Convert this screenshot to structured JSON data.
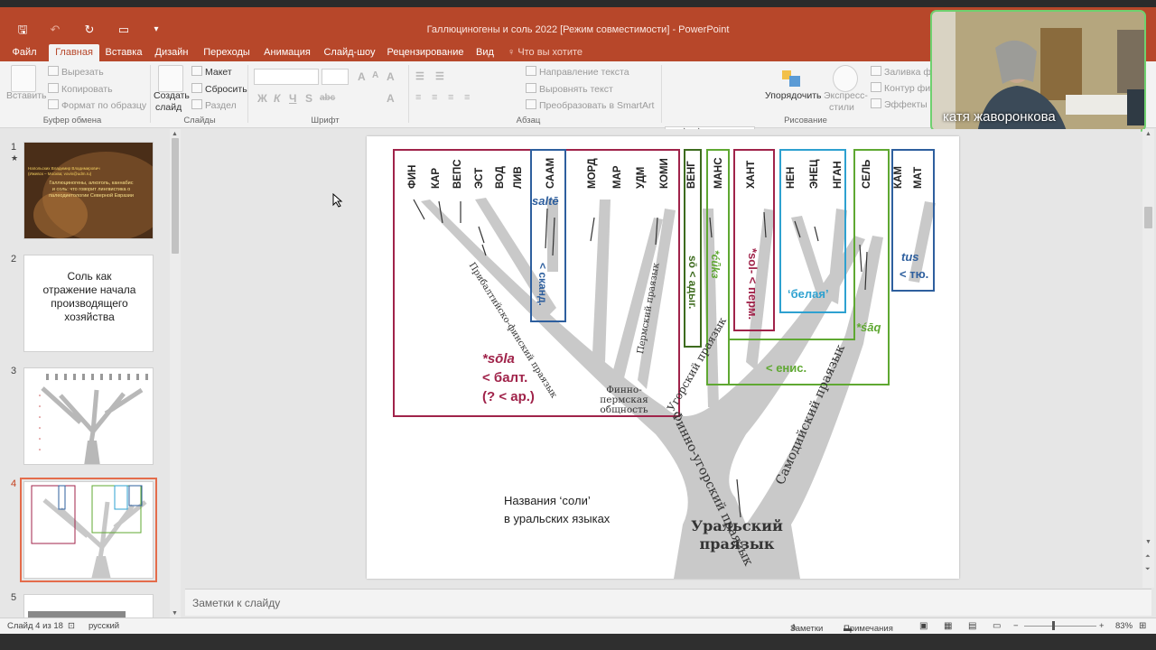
{
  "window": {
    "title": "Галлюциногены и соль 2022 [Режим совместимости] - PowerPoint"
  },
  "quick_access": {
    "icons": [
      "save-icon",
      "undo-icon",
      "redo-icon",
      "present-icon",
      "customize-icon"
    ]
  },
  "tabs": [
    {
      "label": "Файл"
    },
    {
      "label": "Главная"
    },
    {
      "label": "Вставка"
    },
    {
      "label": "Дизайн"
    },
    {
      "label": "Переходы"
    },
    {
      "label": "Анимация"
    },
    {
      "label": "Слайд-шоу"
    },
    {
      "label": "Рецензирование"
    },
    {
      "label": "Вид"
    }
  ],
  "search_tab": "Что вы хотите сделать?",
  "ribbon": {
    "clipboard": {
      "paste": "Вставить",
      "cut": "Вырезать",
      "copy": "Копировать",
      "format_painter": "Формат по образцу",
      "group": "Буфер обмена"
    },
    "slides": {
      "new_slide_line1": "Создать",
      "new_slide_line2": "слайд",
      "layout": "Макет",
      "reset": "Сбросить",
      "section": "Раздел",
      "group": "Слайды"
    },
    "font": {
      "bold": "Ж",
      "italic": "К",
      "underline": "Ч",
      "shadow": "S",
      "strike": "abc",
      "group": "Шрифт"
    },
    "paragraph": {
      "text_direction": "Направление текста",
      "align_text": "Выровнять текст",
      "smartart": "Преобразовать в SmartArt",
      "group": "Абзац"
    },
    "drawing": {
      "arrange": "Упорядочить",
      "quick_styles_line1": "Экспресс-",
      "quick_styles_line2": "стили",
      "shape_fill": "Заливка фи",
      "shape_outline": "Контур фи",
      "shape_effects": "Эффекты ф",
      "group": "Рисование"
    }
  },
  "thumbnails": {
    "slide1": {
      "num": "1",
      "author": "Напольских Владимир Владимирович",
      "affil": "(Ижевск – Москва; vovin@udm.ru)",
      "title": "Галлюциногены, алкоголь, каннабис и соль: что говорит лингвистика о палеодиетологии Северной Евразии"
    },
    "slide2": {
      "num": "2",
      "text": "Соль как отражение начала производящего хозяйства"
    },
    "slide3": {
      "num": "3"
    },
    "slide4": {
      "num": "4"
    },
    "slide5": {
      "num": "5"
    }
  },
  "slide": {
    "languages": [
      "ФИН",
      "КАР",
      "ВЕПС",
      "ЭСТ",
      "ВОД",
      "ЛИВ",
      "СААМ",
      "МОРД",
      "МАР",
      "УДМ",
      "КОМИ",
      "ВЕНГ",
      "МАНС",
      "ХАНТ",
      "НЕН",
      "ЭНЕЦ",
      "НГАН",
      "СЕЛЬ",
      "КАМ",
      "МАТ"
    ],
    "branch_labels": {
      "baltic_finnic": "Прибалтийско-финский праязык",
      "permic": "Пермский праязык",
      "finno_permic": "Финно-пермская общность",
      "ugric": "Угорский праязык",
      "finno_ugric": "Финно-угорский праязык",
      "samoyedic": "Самодийский праязык",
      "uralic_line1": "Уральский",
      "uralic_line2": "праязык"
    },
    "annotations": {
      "saltte": "saltē",
      "saam_source": "< сканд.",
      "sola": "*sōla",
      "sola_source1": "< балт.",
      "sola_source2": "(? < ар.)",
      "so": "sō < адыг.",
      "suka": "*ćǖkз",
      "sol": "*sol- < перм.",
      "belaya": "‘белая’",
      "saaq": "*śāq",
      "enis": "< енис.",
      "tus": "tus",
      "tyu": "< тю."
    },
    "caption_line1": "Названия ‘соли’",
    "caption_line2": "в уральских языках"
  },
  "notes_placeholder": "Заметки к слайду",
  "status": {
    "slide_count": "Слайд 4 из 18",
    "language": "русский",
    "notes_btn": "Заметки",
    "comments_btn": "Примечания",
    "zoom": "83%",
    "zoom_level": 0.83
  },
  "video": {
    "participant": "катя жаворонкова"
  },
  "colors": {
    "accent": "#b7472a",
    "baltic_box": "#a0234a",
    "saam_box": "#2e5f9e",
    "ugric_box": "#5fa832",
    "khanty_box": "#a0234a",
    "samoyed_box": "#2ea1d0",
    "tree": "#c9c9c9"
  }
}
